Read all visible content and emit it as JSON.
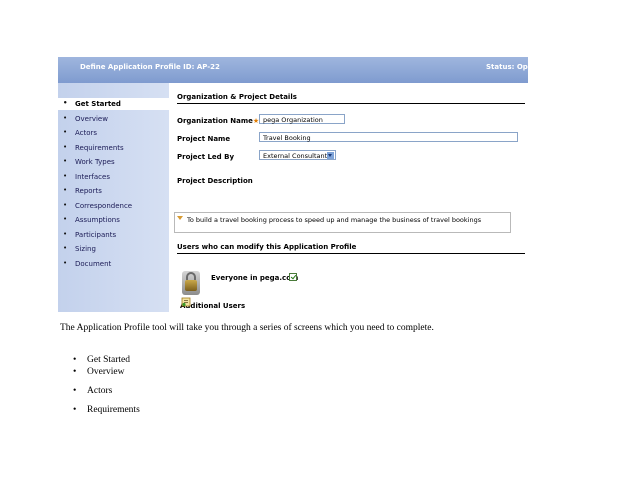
{
  "screenshot": {
    "title_left": "Define Application Profile  ID: AP-22",
    "title_right": "Status: Ope",
    "nav": [
      {
        "label": "Get Started",
        "active": true
      },
      {
        "label": "Overview"
      },
      {
        "label": "Actors"
      },
      {
        "label": "Requirements"
      },
      {
        "label": "Work Types"
      },
      {
        "label": "Interfaces"
      },
      {
        "label": "Reports"
      },
      {
        "label": "Correspondence"
      },
      {
        "label": "Assumptions"
      },
      {
        "label": "Participants"
      },
      {
        "label": "Sizing"
      },
      {
        "label": "Document"
      }
    ],
    "bullet_glyph": "•",
    "section_title": "Organization & Project Details",
    "org_label": "Organization Name",
    "required_mark": "★",
    "org_value": "pega Organization",
    "project_label": "Project Name",
    "project_value": "Travel Booking",
    "led_label": "Project Led By",
    "led_value": "External Consultants",
    "desc_label": "Project Description",
    "desc_value": "To build a  travel booking process to speed up and manage the business of travel bookings",
    "users_title": "Users who can modify this Application Profile",
    "everyone_label": "Everyone in pega.com",
    "everyone_checked": true,
    "additional_users_label": "Additional Users",
    "accent_color": "#8aa5d6",
    "icons": [
      "lock-icon",
      "checkbox-icon",
      "add-user-icon",
      "dropdown-arrow-icon",
      "expand-triangle-icon"
    ]
  },
  "document": {
    "paragraph": "The Application Profile tool will take you through a series of screens which you need to complete.",
    "bullet_glyph": "•",
    "list": [
      "Get Started",
      "Overview",
      "Actors",
      "Requirements"
    ]
  }
}
